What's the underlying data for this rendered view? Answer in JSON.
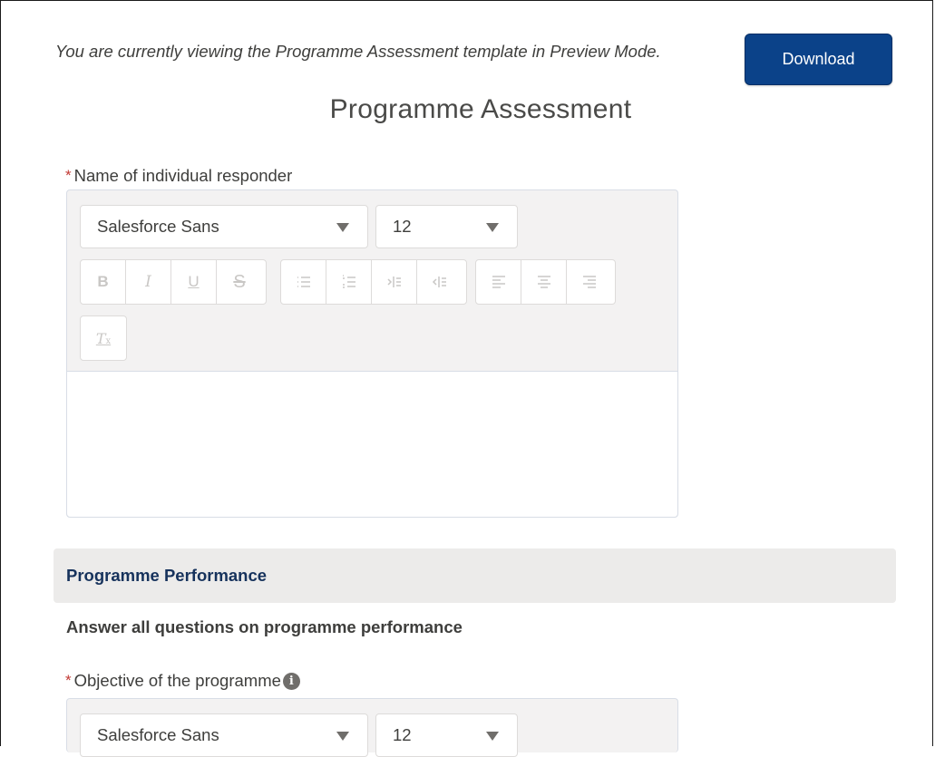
{
  "notice": "You are currently viewing the Programme Assessment template in Preview Mode.",
  "download_label": "Download",
  "page_title": "Programme Assessment",
  "required_marker": "*",
  "fields": [
    {
      "label": "Name of individual responder",
      "font_family_value": "Salesforce Sans",
      "font_size_value": "12"
    },
    {
      "label": "Objective of the programme",
      "font_family_value": "Salesforce Sans",
      "font_size_value": "12"
    }
  ],
  "toolbar": {
    "bold": "B",
    "italic": "I",
    "underline": "U",
    "strikethrough": "S",
    "clear_formatting": "T"
  },
  "section": {
    "title": "Programme Performance",
    "subtitle": "Answer all questions on programme performance"
  },
  "icons": {
    "dropdown": "chevron-down-icon",
    "info": "info-icon"
  },
  "colors": {
    "brand_button": "#0b4289",
    "required": "#c23934",
    "section_bg": "#ecebea",
    "section_title": "#16325c"
  }
}
